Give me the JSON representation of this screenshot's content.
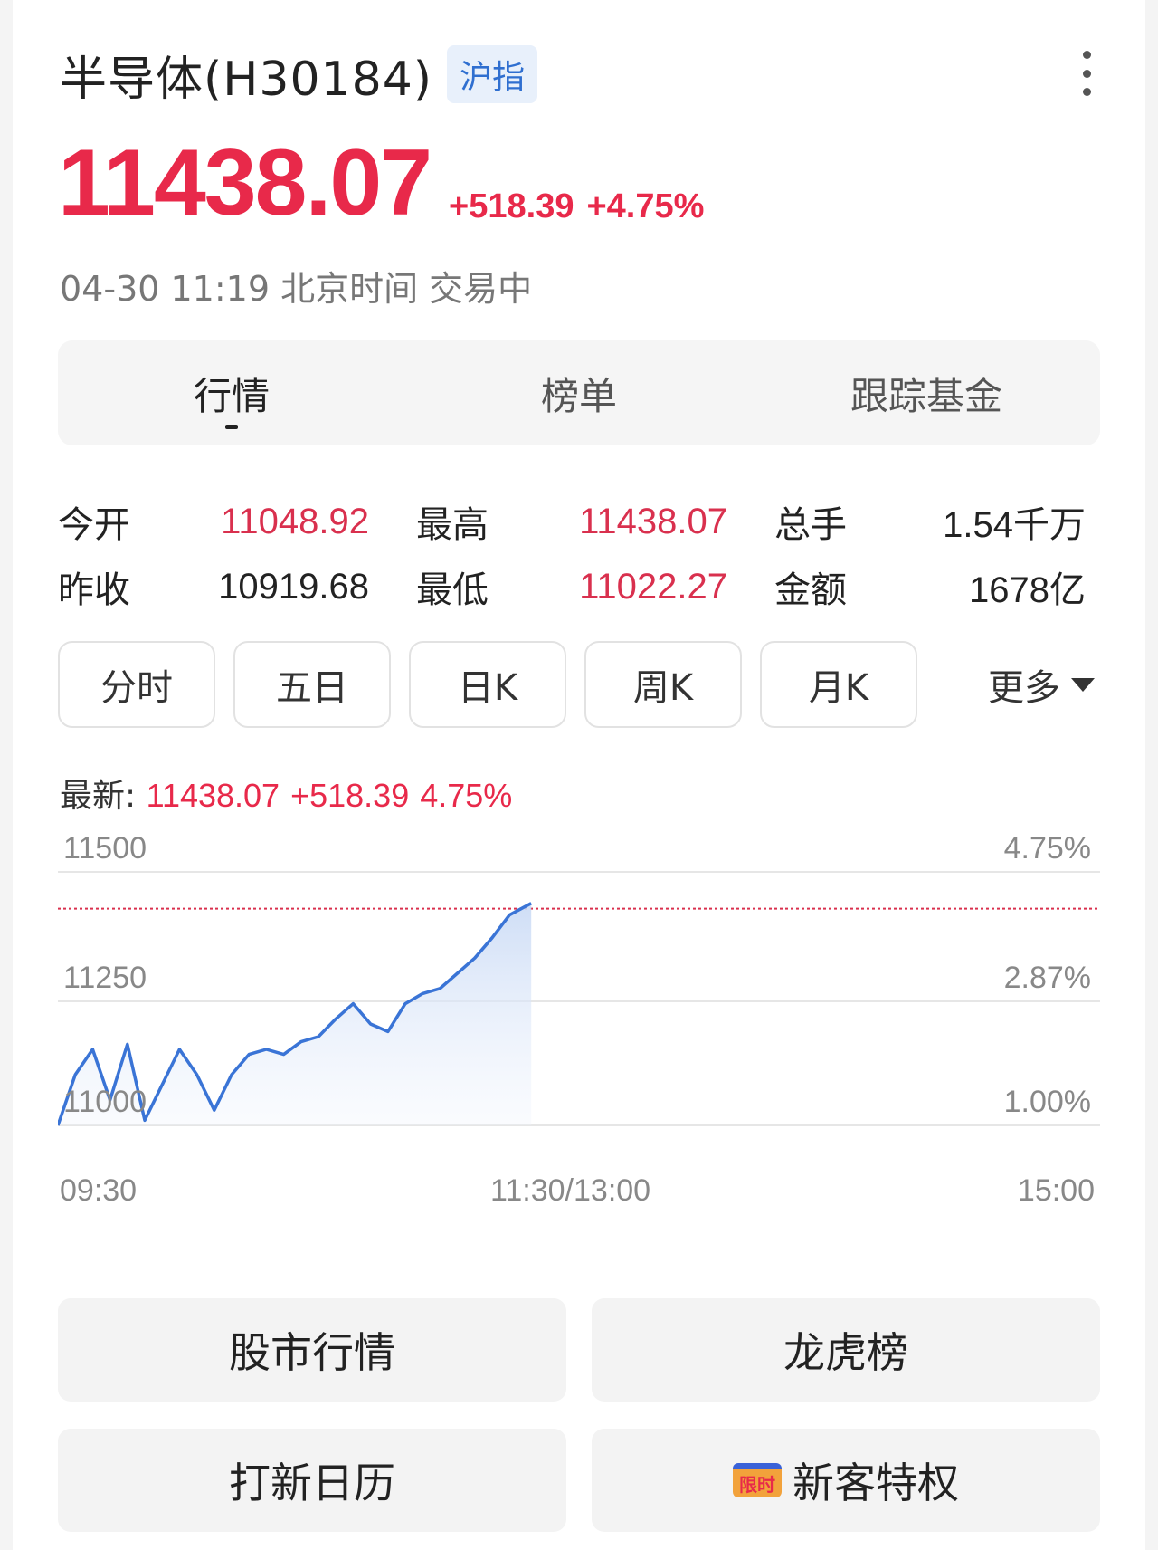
{
  "header": {
    "title": "半导体(H30184)",
    "badge": "沪指"
  },
  "quote": {
    "price": "11438.07",
    "change": "+518.39",
    "change_pct": "+4.75%",
    "timeline": "04-30 11:19 北京时间 交易中"
  },
  "tabs": [
    {
      "label": "行情",
      "active": true
    },
    {
      "label": "榜单",
      "active": false
    },
    {
      "label": "跟踪基金",
      "active": false
    }
  ],
  "stats": [
    [
      {
        "label": "今开",
        "value": "11048.92",
        "tone": "up"
      },
      {
        "label": "最高",
        "value": "11438.07",
        "tone": "up"
      },
      {
        "label": "总手",
        "value": "1.54千万",
        "tone": "flat"
      }
    ],
    [
      {
        "label": "昨收",
        "value": "10919.68",
        "tone": "flat"
      },
      {
        "label": "最低",
        "value": "11022.27",
        "tone": "up"
      },
      {
        "label": "金额",
        "value": "1678亿",
        "tone": "flat"
      }
    ]
  ],
  "periods": [
    "分时",
    "五日",
    "日K",
    "周K",
    "月K"
  ],
  "period_more": "更多",
  "latest": {
    "label": "最新:",
    "price": "11438.07",
    "change": "+518.39",
    "change_pct": "4.75%"
  },
  "chart_data": {
    "type": "line",
    "y_ticks_left": [
      "11500",
      "11250",
      "11000"
    ],
    "y_ticks_right": [
      "4.75%",
      "2.87%",
      "1.00%"
    ],
    "x_ticks": [
      "09:30",
      "11:30/13:00",
      "15:00"
    ],
    "ylim": [
      11000,
      11500
    ],
    "reference_level": 11438.07,
    "x": [
      "09:30",
      "09:34",
      "09:38",
      "09:42",
      "09:46",
      "09:50",
      "09:54",
      "09:58",
      "10:02",
      "10:06",
      "10:10",
      "10:14",
      "10:18",
      "10:22",
      "10:26",
      "10:30",
      "10:34",
      "10:38",
      "10:42",
      "10:46",
      "10:50",
      "10:54",
      "10:58",
      "11:02",
      "11:06",
      "11:10",
      "11:14",
      "11:19"
    ],
    "values": [
      11000,
      11100,
      11150,
      11050,
      11160,
      11010,
      11080,
      11150,
      11100,
      11030,
      11100,
      11140,
      11150,
      11140,
      11165,
      11175,
      11210,
      11240,
      11200,
      11185,
      11240,
      11260,
      11270,
      11300,
      11330,
      11370,
      11415,
      11438
    ],
    "colors": {
      "line": "#3a74d6",
      "ref_line": "#d9304e"
    }
  },
  "quick_links": [
    {
      "label": "股市行情"
    },
    {
      "label": "龙虎榜"
    },
    {
      "label": "打新日历"
    },
    {
      "label": "新客特权",
      "tag": "限时"
    }
  ]
}
